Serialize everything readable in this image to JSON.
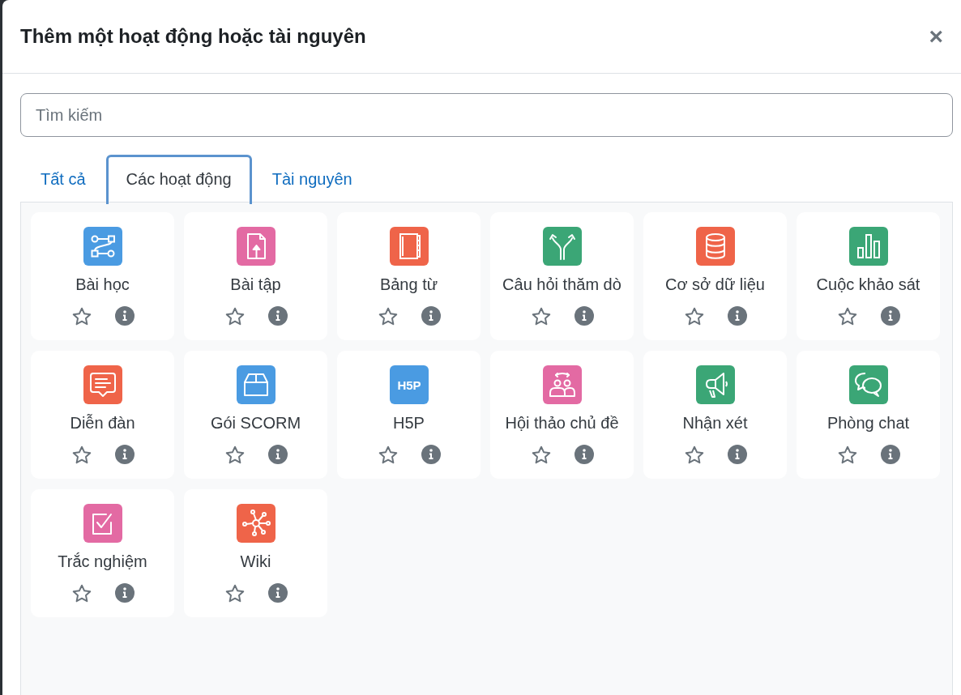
{
  "dialog": {
    "title": "Thêm một hoạt động hoặc tài nguyên",
    "close": "×"
  },
  "search": {
    "placeholder": "Tìm kiếm"
  },
  "tabs": [
    {
      "label": "Tất cả",
      "selected": false
    },
    {
      "label": "Các hoạt động",
      "selected": true
    },
    {
      "label": "Tài nguyên",
      "selected": false
    }
  ],
  "modules": [
    {
      "name": "Bài học",
      "color": "#4a9be2",
      "starred": false
    },
    {
      "name": "Bài tập",
      "color": "#e36aa3",
      "starred": false
    },
    {
      "name": "Bảng từ",
      "color": "#ef6449",
      "starred": false
    },
    {
      "name": "Câu hỏi thăm dò",
      "color": "#3ba676",
      "starred": false
    },
    {
      "name": "Cơ sở dữ liệu",
      "color": "#ef6449",
      "starred": false
    },
    {
      "name": "Cuộc khảo sát",
      "color": "#3ba676",
      "starred": false
    },
    {
      "name": "Diễn đàn",
      "color": "#ef6449",
      "starred": false
    },
    {
      "name": "Gói SCORM",
      "color": "#4a9be2",
      "starred": false
    },
    {
      "name": "H5P",
      "color": "#4a9be2",
      "starred": false,
      "logo": "H5P"
    },
    {
      "name": "Hội thảo chủ đề",
      "color": "#e36aa3",
      "starred": false
    },
    {
      "name": "Nhận xét",
      "color": "#3ba676",
      "starred": false
    },
    {
      "name": "Phòng chat",
      "color": "#3ba676",
      "starred": false
    },
    {
      "name": "Trắc nghiệm",
      "color": "#e36aa3",
      "starred": false
    },
    {
      "name": "Wiki",
      "color": "#ef6449",
      "starred": false
    }
  ]
}
